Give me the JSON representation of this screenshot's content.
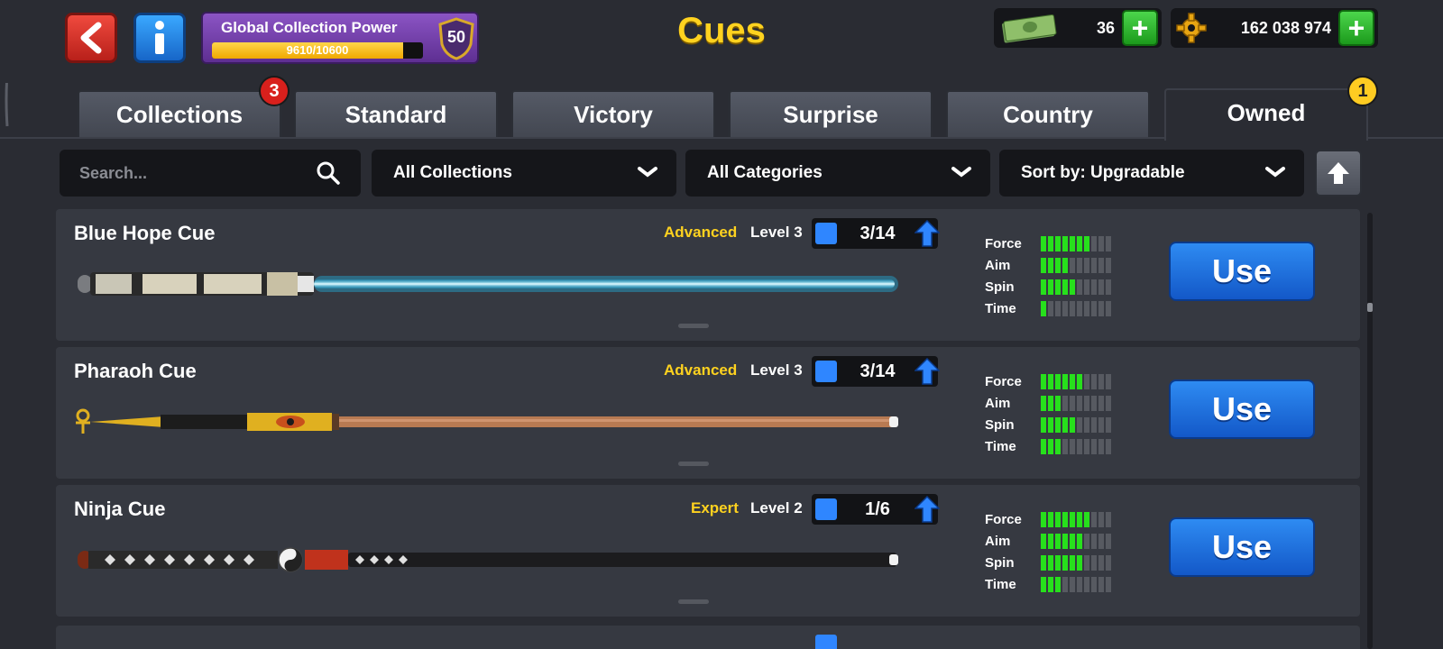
{
  "header": {
    "title": "Cues",
    "collection_power": {
      "label": "Global Collection Power",
      "progress_text": "9610/10600",
      "progress": 0.906,
      "level": "50"
    },
    "cash": {
      "value": "36",
      "plus": "+"
    },
    "coins": {
      "value": "162 038 974",
      "plus": "+"
    }
  },
  "tabs": [
    {
      "label": "Collections",
      "badge": "3"
    },
    {
      "label": "Standard"
    },
    {
      "label": "Victory"
    },
    {
      "label": "Surprise"
    },
    {
      "label": "Country"
    },
    {
      "label": "Owned",
      "badge": "1",
      "active": true
    }
  ],
  "filters": {
    "search_placeholder": "Search...",
    "collections": "All Collections",
    "categories": "All Categories",
    "sort": "Sort by: Upgradable"
  },
  "cues": [
    {
      "name": "Blue Hope Cue",
      "tier": "Advanced",
      "level": "Level 3",
      "progress": "3/14",
      "stats": [
        {
          "label": "Force",
          "value": 7
        },
        {
          "label": "Aim",
          "value": 4
        },
        {
          "label": "Spin",
          "value": 5
        },
        {
          "label": "Time",
          "value": 1
        }
      ],
      "button": "Use"
    },
    {
      "name": "Pharaoh Cue",
      "tier": "Advanced",
      "level": "Level 3",
      "progress": "3/14",
      "stats": [
        {
          "label": "Force",
          "value": 6
        },
        {
          "label": "Aim",
          "value": 3
        },
        {
          "label": "Spin",
          "value": 5
        },
        {
          "label": "Time",
          "value": 3
        }
      ],
      "button": "Use"
    },
    {
      "name": "Ninja Cue",
      "tier": "Expert",
      "level": "Level 2",
      "progress": "1/6",
      "stats": [
        {
          "label": "Force",
          "value": 7
        },
        {
          "label": "Aim",
          "value": 6
        },
        {
          "label": "Spin",
          "value": 6
        },
        {
          "label": "Time",
          "value": 3
        }
      ],
      "button": "Use"
    }
  ],
  "colors": {
    "tier": "#ffd21f",
    "stat_on": "#27e01c",
    "stat_off": "#575a61",
    "use_button": "#1d6fe0",
    "title": "#ffd21f"
  }
}
